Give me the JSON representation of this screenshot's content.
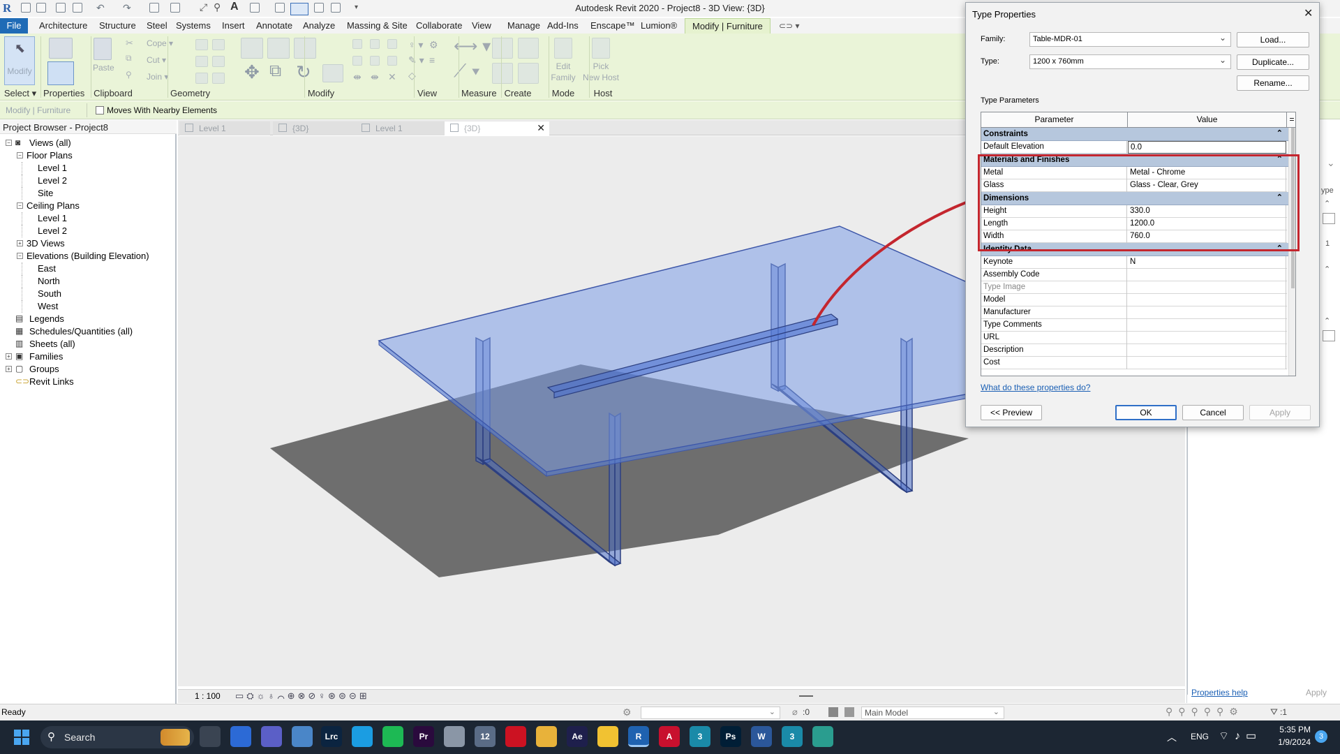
{
  "window": {
    "title": "Autodesk Revit 2020 - Project8 - 3D View: {3D}"
  },
  "menu": {
    "file": "File",
    "tabs": [
      "Architecture",
      "Structure",
      "Steel",
      "Systems",
      "Insert",
      "Annotate",
      "Analyze",
      "Massing & Site",
      "Collaborate",
      "View",
      "Manage",
      "Add-Ins",
      "Enscape™",
      "Lumion®"
    ],
    "active_tab": "Modify | Furniture"
  },
  "ribbon": {
    "panels": [
      {
        "label": "Select",
        "has_dropdown": true
      },
      {
        "label": "Properties"
      },
      {
        "label": "Clipboard"
      },
      {
        "label": "Geometry"
      },
      {
        "label": "Modify"
      },
      {
        "label": "View"
      },
      {
        "label": "Measure"
      },
      {
        "label": "Create"
      },
      {
        "label": "Mode"
      },
      {
        "label": "Host"
      }
    ],
    "buttons": {
      "modify": "Modify",
      "paste": "Paste",
      "cope": "Cope",
      "cut": "Cut",
      "join": "Join",
      "edit_family_1": "Edit",
      "edit_family_2": "Family",
      "pick_host_1": "Pick",
      "pick_host_2": "New Host"
    }
  },
  "options_bar": {
    "context": "Modify | Furniture",
    "checkbox_label": "Moves With Nearby Elements",
    "checked": false
  },
  "project_browser": {
    "title": "Project Browser - Project8",
    "items": [
      {
        "label": "Views (all)",
        "level": 0,
        "toggle": "−",
        "icon": "views"
      },
      {
        "label": "Floor Plans",
        "level": 1,
        "toggle": "−"
      },
      {
        "label": "Level 1",
        "level": 2
      },
      {
        "label": "Level 2",
        "level": 2
      },
      {
        "label": "Site",
        "level": 2
      },
      {
        "label": "Ceiling Plans",
        "level": 1,
        "toggle": "−"
      },
      {
        "label": "Level 1",
        "level": 2
      },
      {
        "label": "Level 2",
        "level": 2
      },
      {
        "label": "3D Views",
        "level": 1,
        "toggle": "+"
      },
      {
        "label": "Elevations (Building Elevation)",
        "level": 1,
        "toggle": "−"
      },
      {
        "label": "East",
        "level": 2
      },
      {
        "label": "North",
        "level": 2
      },
      {
        "label": "South",
        "level": 2
      },
      {
        "label": "West",
        "level": 2
      },
      {
        "label": "Legends",
        "level": 0,
        "icon": "legend"
      },
      {
        "label": "Schedules/Quantities (all)",
        "level": 0,
        "icon": "schedule"
      },
      {
        "label": "Sheets (all)",
        "level": 0,
        "icon": "sheet"
      },
      {
        "label": "Families",
        "level": 0,
        "toggle": "+",
        "icon": "family"
      },
      {
        "label": "Groups",
        "level": 0,
        "toggle": "+",
        "icon": "group"
      },
      {
        "label": "Revit Links",
        "level": 0,
        "icon": "link"
      }
    ]
  },
  "view_tabs": [
    {
      "label": "Level 1",
      "active": false
    },
    {
      "label": "{3D}",
      "active": false
    },
    {
      "label": "Level 1",
      "active": false
    },
    {
      "label": "{3D}",
      "active": true
    }
  ],
  "view_control_bar": {
    "scale": "1 : 100"
  },
  "properties_pane": {
    "help_link": "Properties help",
    "apply": "Apply",
    "type_label_fragment": "ype",
    "value_fragment": "1"
  },
  "dialog": {
    "title": "Type Properties",
    "family_label": "Family:",
    "family_value": "Table-MDR-01",
    "type_label": "Type:",
    "type_value": "1200 x 760mm",
    "load_button": "Load...",
    "duplicate_button": "Duplicate...",
    "rename_button": "Rename...",
    "type_parameters_label": "Type Parameters",
    "columns": {
      "parameter": "Parameter",
      "value": "Value",
      "eq": "="
    },
    "groups": [
      {
        "name": "Constraints",
        "rows": [
          {
            "param": "Default Elevation",
            "value": "0.0",
            "editing": true
          }
        ]
      },
      {
        "name": "Materials and Finishes",
        "rows": [
          {
            "param": "Metal",
            "value": "Metal - Chrome"
          },
          {
            "param": "Glass",
            "value": "Glass - Clear, Grey"
          }
        ]
      },
      {
        "name": "Dimensions",
        "rows": [
          {
            "param": "Height",
            "value": "330.0"
          },
          {
            "param": "Length",
            "value": "1200.0"
          },
          {
            "param": "Width",
            "value": "760.0"
          }
        ]
      },
      {
        "name": "Identity Data",
        "rows": [
          {
            "param": "Keynote",
            "value": "N"
          },
          {
            "param": "Assembly Code",
            "value": ""
          },
          {
            "param": "Type Image",
            "value": "",
            "dim": true
          },
          {
            "param": "Model",
            "value": ""
          },
          {
            "param": "Manufacturer",
            "value": ""
          },
          {
            "param": "Type Comments",
            "value": ""
          },
          {
            "param": "URL",
            "value": ""
          },
          {
            "param": "Description",
            "value": ""
          },
          {
            "param": "Cost",
            "value": ""
          }
        ]
      }
    ],
    "help_link": "What do these properties do?",
    "preview_button": "<< Preview",
    "ok_button": "OK",
    "cancel_button": "Cancel",
    "apply_button": "Apply"
  },
  "status_bar": {
    "text": "Ready",
    "zero": ":0",
    "workset": "Main Model",
    "filter_count": ":1"
  },
  "taskbar": {
    "search_placeholder": "Search",
    "language": "ENG",
    "time": "5:35 PM",
    "date": "1/9/2024",
    "notification_count": "3",
    "apps": [
      {
        "name": "task-view",
        "color": "#3a4452"
      },
      {
        "name": "store",
        "color": "#2c6ad6"
      },
      {
        "name": "teams",
        "color": "#5b5fc7"
      },
      {
        "name": "photos",
        "color": "#4a86c8"
      },
      {
        "name": "lightroom",
        "color": "#0b2440",
        "glyph": "Lrc"
      },
      {
        "name": "edge",
        "color": "#1b9de2"
      },
      {
        "name": "spotify",
        "color": "#1db954"
      },
      {
        "name": "premiere",
        "color": "#2a0a3d",
        "glyph": "Pr"
      },
      {
        "name": "app-circle",
        "color": "#8a96a6"
      },
      {
        "name": "calendar-app",
        "color": "#5a6c86",
        "glyph": "12"
      },
      {
        "name": "opera",
        "color": "#cc1222"
      },
      {
        "name": "media",
        "color": "#e8b23a"
      },
      {
        "name": "after-effects",
        "color": "#1e1f4c",
        "glyph": "Ae"
      },
      {
        "name": "file-explorer",
        "color": "#f1c232"
      },
      {
        "name": "revit",
        "color": "#1f62b0",
        "glyph": "R"
      },
      {
        "name": "autocad",
        "color": "#c8102e",
        "glyph": "A"
      },
      {
        "name": "3dsmax",
        "color": "#1a8aa8",
        "glyph": "3"
      },
      {
        "name": "photoshop",
        "color": "#001e36",
        "glyph": "Ps"
      },
      {
        "name": "word",
        "color": "#2b579a",
        "glyph": "W"
      },
      {
        "name": "3dsmax-2",
        "color": "#1a8aa8",
        "glyph": "3"
      },
      {
        "name": "globe-app",
        "color": "#2a9d8f"
      }
    ]
  },
  "colors": {
    "accent": "#1f6bb6",
    "highlight_border": "#c4262e",
    "group_header": "#b6c7dd",
    "ribbon_bg": "#eaf4d8",
    "taskbar": "#1c2633"
  }
}
